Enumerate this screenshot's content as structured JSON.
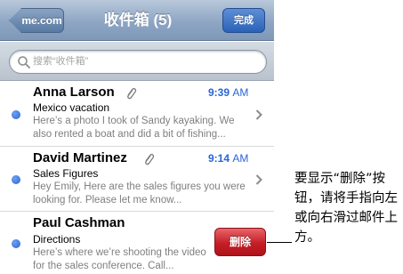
{
  "navbar": {
    "back_label": "me.com",
    "title": "收件箱 (5)",
    "done_label": "完成"
  },
  "search": {
    "placeholder": "搜索“收件箱”"
  },
  "messages": [
    {
      "sender": "Anna Larson",
      "has_attachment": true,
      "time": "9:39",
      "ampm": "AM",
      "subject": "Mexico vacation",
      "preview": "Here’s a photo I took of Sandy kayaking. We also rented a boat and did a bit of fishing...",
      "unread": true
    },
    {
      "sender": "David Martinez",
      "has_attachment": true,
      "time": "9:14",
      "ampm": "AM",
      "subject": "Sales Figures",
      "preview": "Hey Emily, Here are the sales figures you were looking for. Please let me know...",
      "unread": true
    },
    {
      "sender": "Paul Cashman",
      "has_attachment": false,
      "time": "",
      "ampm": "",
      "subject": "Directions",
      "preview": "Here’s where we’re shooting the video for the sales conference. Call...",
      "unread": true
    }
  ],
  "delete_label": "删除",
  "callout": "要显示“删除”按钮，请将手指向左或向右滑过邮件上方。",
  "colors": {
    "accent_blue": "#2a64d8",
    "delete_red": "#c51e26"
  }
}
